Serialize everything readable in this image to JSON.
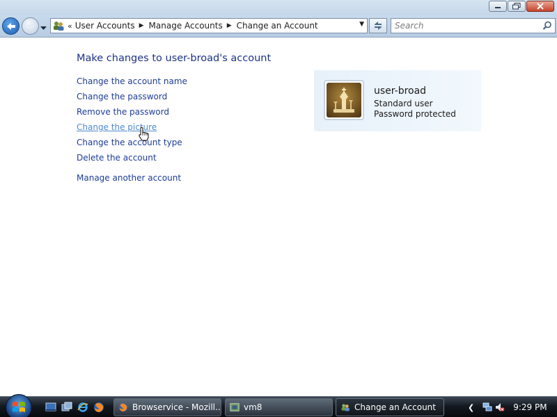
{
  "address": {
    "crumbs": [
      "User Accounts",
      "Manage Accounts",
      "Change an Account"
    ]
  },
  "search": {
    "placeholder": "Search"
  },
  "content": {
    "title": "Make changes to user-broad's account",
    "tasks": [
      "Change the account name",
      "Change the password",
      "Remove the password",
      "Change the picture",
      "Change the account type",
      "Delete the account"
    ],
    "manage_other": "Manage another account"
  },
  "account": {
    "name": "user-broad",
    "type": "Standard user",
    "status": "Password protected"
  },
  "taskbar": {
    "buttons": [
      "Browservice - Mozill...",
      "vm8",
      "Change an Account"
    ],
    "clock": "9:29 PM"
  }
}
